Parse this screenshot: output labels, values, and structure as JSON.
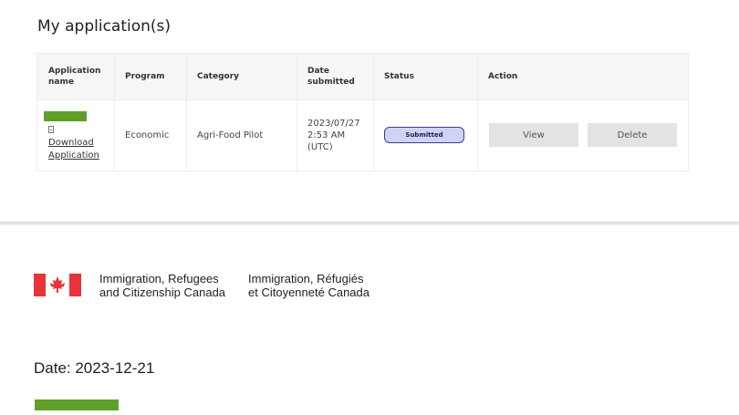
{
  "page_title": "My application(s)",
  "table": {
    "headers": {
      "app_name": [
        "Application",
        "name"
      ],
      "program": "Program",
      "category": "Category",
      "date_submitted": [
        "Date",
        "submitted"
      ],
      "status": "Status",
      "action": "Action"
    },
    "row": {
      "download_link": [
        "Download",
        "Application"
      ],
      "program": "Economic",
      "category": "Agri-Food Pilot",
      "date": [
        "2023/07/27",
        "2:53 AM",
        "(UTC)"
      ],
      "status": "Submitted",
      "view_label": "View",
      "delete_label": "Delete"
    }
  },
  "letter": {
    "org_en": [
      "Immigration, Refugees",
      "and Citizenship Canada"
    ],
    "org_fr": [
      "Immigration, Réfugiés",
      "et Citoyenneté Canada"
    ],
    "date_line": "Date: 2023-12-21"
  },
  "colors": {
    "redaction": "#5f9f2a",
    "flag_red": "#e8333a",
    "status_fill": "#cfd3f7",
    "status_border": "#3a3e8c"
  },
  "icons": {
    "document": "document-icon",
    "flag": "canada-flag-icon"
  }
}
